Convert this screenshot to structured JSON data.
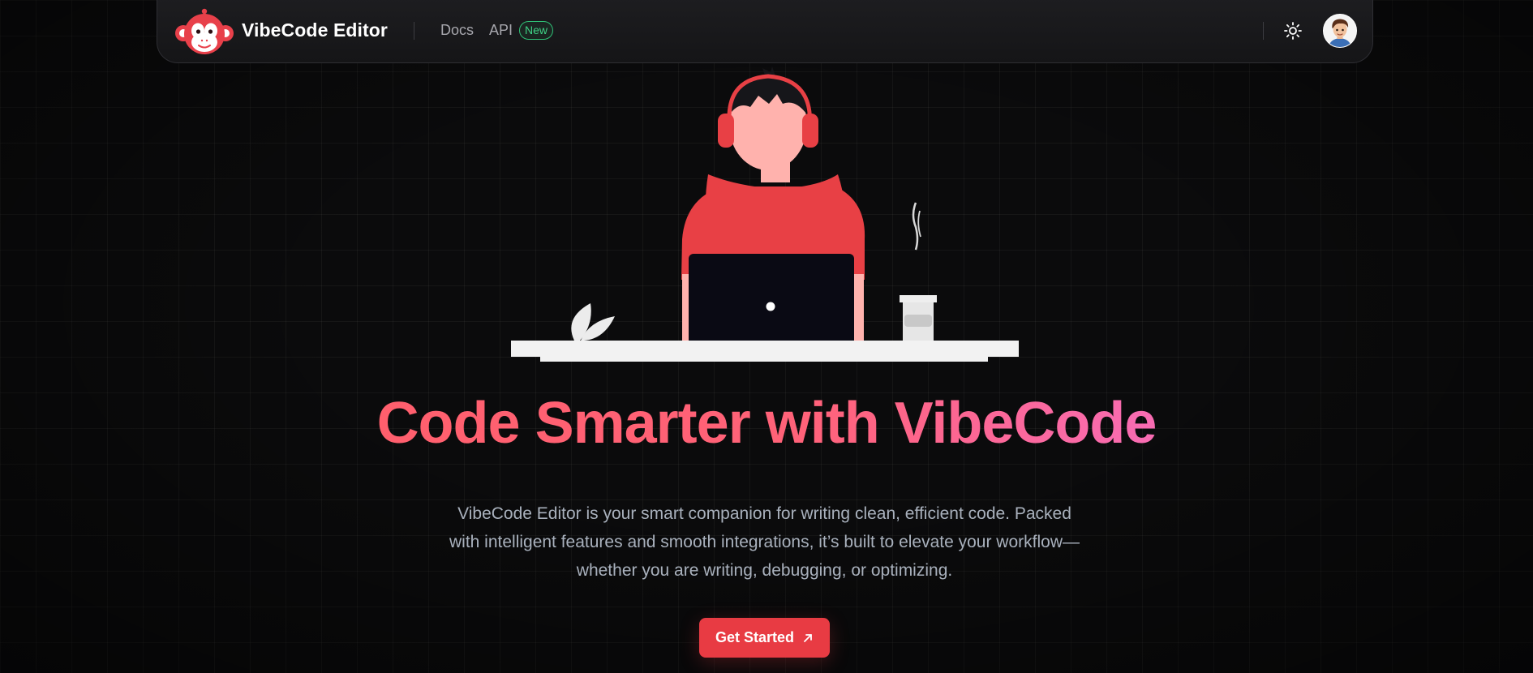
{
  "navbar": {
    "brand_name": "VibeCode Editor",
    "links": [
      {
        "label": "Docs"
      },
      {
        "label": "API"
      }
    ],
    "api_badge": "New"
  },
  "icons": {
    "logo": "monkey-logo-icon",
    "theme_toggle": "sun-icon",
    "avatar": "user-avatar",
    "cta": "arrow-up-right-icon"
  },
  "hero": {
    "title": "Code Smarter with VibeCode",
    "description": "VibeCode Editor is your smart companion for writing clean, efficient code. Packed with intelligent features and smooth integrations, it’s built to elevate your workflow—whether you are writing, debugging, or optimizing.",
    "cta_label": "Get Started"
  },
  "colors": {
    "accent": "#e83b43",
    "title_gradient_start": "#ff5f6d",
    "title_gradient_end": "#f86cb3",
    "badge_green": "#2fbf76",
    "background": "#0b0b0c"
  }
}
